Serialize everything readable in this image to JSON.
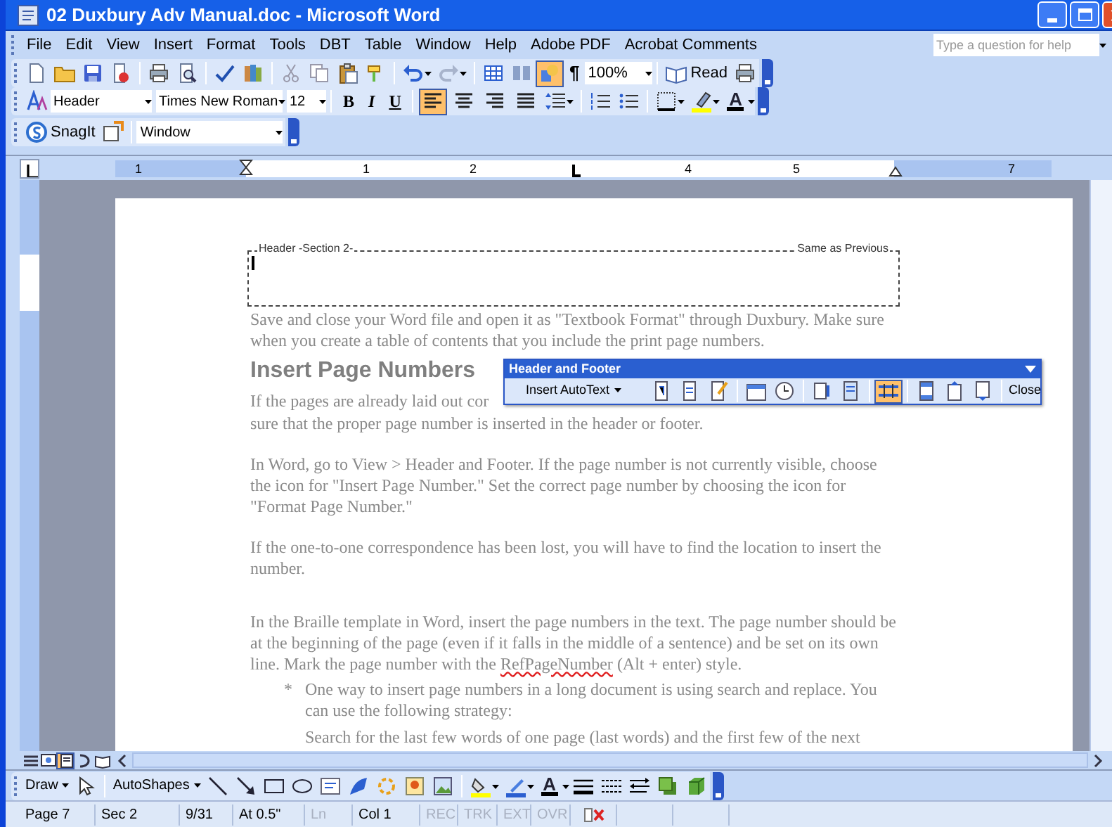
{
  "window": {
    "title": "02 Duxbury Adv Manual.doc - Microsoft Word"
  },
  "menu": [
    "File",
    "Edit",
    "View",
    "Insert",
    "Format",
    "Tools",
    "DBT",
    "Table",
    "Window",
    "Help",
    "Adobe PDF",
    "Acrobat Comments"
  ],
  "help_box": {
    "placeholder": "Type a question for help"
  },
  "standard_toolbar": {
    "drawing_button": {
      "selected": true
    },
    "pilcrow": "¶",
    "zoom": "100%",
    "read": "Read"
  },
  "formatting_toolbar": {
    "style": "Header",
    "font": "Times New Roman",
    "size": "12",
    "bold": "B",
    "italic": "I",
    "underline": "U",
    "alignment": [
      {
        "kind": "left",
        "selected": true
      },
      {
        "kind": "center",
        "selected": false
      },
      {
        "kind": "right",
        "selected": false
      },
      {
        "kind": "justify",
        "selected": false
      }
    ],
    "font_color": "A"
  },
  "snagit_toolbar": {
    "label": "SnagIt",
    "capture_mode": "Window"
  },
  "ruler": {
    "labels": [
      "1",
      "1",
      "2",
      "4",
      "5",
      "7"
    ]
  },
  "document": {
    "header": {
      "label": "Header -Section 2-",
      "link_note": "Same as Previous"
    },
    "blocks": [
      {
        "kind": "paragraph",
        "text": "Save and close your Word file and open it as \"Textbook Format\" through Duxbury. Make sure when you create a table of contents that you include the print page numbers."
      },
      {
        "kind": "heading",
        "text": "Insert Page Numbers"
      },
      {
        "kind": "line",
        "text": "If the pages are already laid out cor"
      },
      {
        "kind": "line",
        "text": "sure that the proper page number is inserted in the header or footer."
      },
      {
        "kind": "paragraph",
        "text": "In Word, go to View > Header and Footer. If the page number is not currently visible, choose the icon for \"Insert Page Number.\" Set the correct page number by choosing the icon for \"Format Page Number.\""
      },
      {
        "kind": "paragraph",
        "text": "If the one-to-one correspondence has been lost, you will have to find the location to insert the number."
      },
      {
        "kind": "paragraph",
        "segments": [
          {
            "text": "In the Braille template in Word, insert the page numbers in the text. The page number should be at the beginning of the page (even if it falls in the middle of a sentence) and be set on its own line. Mark the page number with the ",
            "misspelled": false
          },
          {
            "text": "RefPageNumber",
            "misspelled": true
          },
          {
            "text": " (Alt + enter) style.",
            "misspelled": false
          }
        ]
      },
      {
        "kind": "bullet",
        "marker": "*",
        "text": "One way to insert page numbers in a long document is using search and replace. You can use the following strategy:"
      },
      {
        "kind": "continuation",
        "text": "Search for the last few words of one page (last words) and the first few of the next"
      }
    ]
  },
  "header_footer_toolbar": {
    "title": "Header and Footer",
    "insert_autotext": "Insert AutoText",
    "buttons": [
      {
        "kind": "page-number",
        "selected": false
      },
      {
        "kind": "page-count",
        "selected": false
      },
      {
        "kind": "format-number",
        "selected": false
      },
      {
        "kind": "date",
        "selected": false
      },
      {
        "kind": "time",
        "selected": false
      },
      {
        "kind": "page-setup",
        "selected": false
      },
      {
        "kind": "show-text",
        "selected": false
      },
      {
        "kind": "link-previous",
        "selected": true
      },
      {
        "kind": "switch",
        "selected": false
      },
      {
        "kind": "previous",
        "selected": false
      },
      {
        "kind": "next",
        "selected": false
      }
    ],
    "close": "Close"
  },
  "view_buttons": [
    {
      "kind": "normal",
      "selected": false
    },
    {
      "kind": "web",
      "selected": false
    },
    {
      "kind": "print",
      "selected": true
    },
    {
      "kind": "outline",
      "selected": false
    },
    {
      "kind": "reading",
      "selected": false
    }
  ],
  "draw_toolbar": {
    "draw": "Draw",
    "autoshapes": "AutoShapes",
    "font_color": "A"
  },
  "status_bar": [
    {
      "text": "Page 7",
      "disabled": false
    },
    {
      "text": "Sec 2",
      "disabled": false
    },
    {
      "text": "9/31",
      "disabled": false
    },
    {
      "text": "At 0.5\"",
      "disabled": false
    },
    {
      "text": "Ln",
      "disabled": true
    },
    {
      "text": "Col 1",
      "disabled": false
    },
    {
      "text": "REC",
      "disabled": true
    },
    {
      "text": "TRK",
      "disabled": true
    },
    {
      "text": "EXT",
      "disabled": true
    },
    {
      "text": "OVR",
      "disabled": true
    }
  ]
}
